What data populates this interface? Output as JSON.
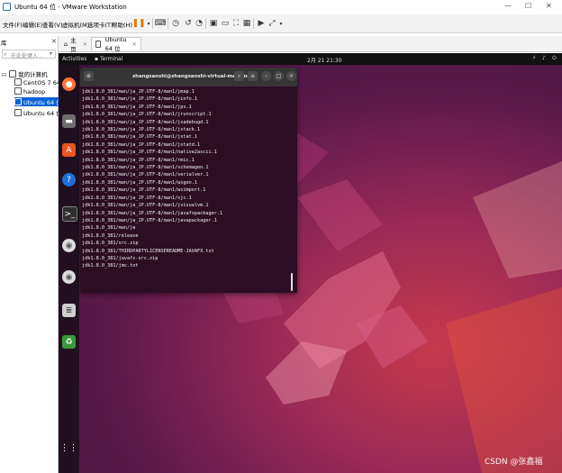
{
  "window": {
    "title": "Ubuntu 64 位 - VMware Workstation",
    "controls": [
      "—",
      "☐",
      "✕"
    ]
  },
  "menu": {
    "items": [
      "文件(F)",
      "编辑(E)",
      "查看(V)",
      "虚拟机(M)",
      "选项卡(T)",
      "帮助(H)"
    ]
  },
  "library": {
    "title": "库",
    "search_placeholder": "在此处键入...",
    "root": "我的计算机",
    "vms": [
      "CentOS 7 64 位",
      "hadoop",
      "Ubuntu 64 位",
      "Ubuntu 64 位"
    ],
    "selected_index": 2
  },
  "tabs": [
    {
      "label": "主页",
      "active": false
    },
    {
      "label": "Ubuntu 64 位",
      "active": true
    }
  ],
  "ubuntu": {
    "activities": "Activities",
    "app_name": "Terminal",
    "clock": "2月 21 21:30"
  },
  "terminal": {
    "title": "zhangsanshi@zhangsanshi-virtual-machine: ~",
    "lines": [
      "jdk1.8.0_381/man/ja_JP.UTF-8/man1/jmap.1",
      "jdk1.8.0_381/man/ja_JP.UTF-8/man1/jinfo.1",
      "jdk1.8.0_381/man/ja_JP.UTF-8/man1/jps.1",
      "jdk1.8.0_381/man/ja_JP.UTF-8/man1/jrunscript.1",
      "jdk1.8.0_381/man/ja_JP.UTF-8/man1/jsadebugd.1",
      "jdk1.8.0_381/man/ja_JP.UTF-8/man1/jstack.1",
      "jdk1.8.0_381/man/ja_JP.UTF-8/man1/jstat.1",
      "jdk1.8.0_381/man/ja_JP.UTF-8/man1/jstatd.1",
      "jdk1.8.0_381/man/ja_JP.UTF-8/man1/native2ascii.1",
      "jdk1.8.0_381/man/ja_JP.UTF-8/man1/rmic.1",
      "jdk1.8.0_381/man/ja_JP.UTF-8/man1/schemagen.1",
      "jdk1.8.0_381/man/ja_JP.UTF-8/man1/serialver.1",
      "jdk1.8.0_381/man/ja_JP.UTF-8/man1/wsgen.1",
      "jdk1.8.0_381/man/ja_JP.UTF-8/man1/wsimport.1",
      "jdk1.8.0_381/man/ja_JP.UTF-8/man1/xjc.1",
      "jdk1.8.0_381/man/ja_JP.UTF-8/man1/jvisualvm.1",
      "jdk1.8.0_381/man/ja_JP.UTF-8/man1/javafxpackager.1",
      "jdk1.8.0_381/man/ja_JP.UTF-8/man1/javapackager.1",
      "jdk1.8.0_381/man/ja",
      "jdk1.8.0_381/release",
      "jdk1.8.0_381/src.zip",
      "jdk1.8.0_381/THIRDPARTYLICENSEREADME-JAVAFX.txt",
      "jdk1.8.0_381/javafx-src.zip",
      "jdk1.8.0_381/jmc.txt"
    ]
  },
  "watermark": "CSDN @张鑫福",
  "colors": {
    "selection": "#0a63d6",
    "terminal_bg": "#2c0d24",
    "firefox": "#ff7139",
    "appcenter": "#e95420"
  }
}
